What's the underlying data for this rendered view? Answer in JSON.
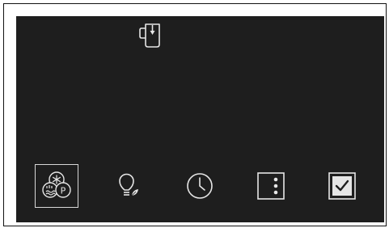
{
  "screen": {
    "status_icon": "jug-water-dispense-icon"
  },
  "bottom_bar": {
    "items": [
      {
        "id": "modes",
        "icon": "freeze-fridge-party-modes-icon",
        "selected": true
      },
      {
        "id": "eco-light",
        "icon": "lightbulb-eco-leaf-icon",
        "selected": false
      },
      {
        "id": "timer",
        "icon": "clock-icon",
        "selected": false
      },
      {
        "id": "more",
        "icon": "more-menu-icon",
        "selected": false
      },
      {
        "id": "confirm",
        "icon": "checkbox-confirm-icon",
        "selected": false
      }
    ]
  },
  "colors": {
    "screen_bg": "#1e1e1e",
    "icon_stroke": "#e6e6e6",
    "selected_border": "#d8d8d8"
  }
}
